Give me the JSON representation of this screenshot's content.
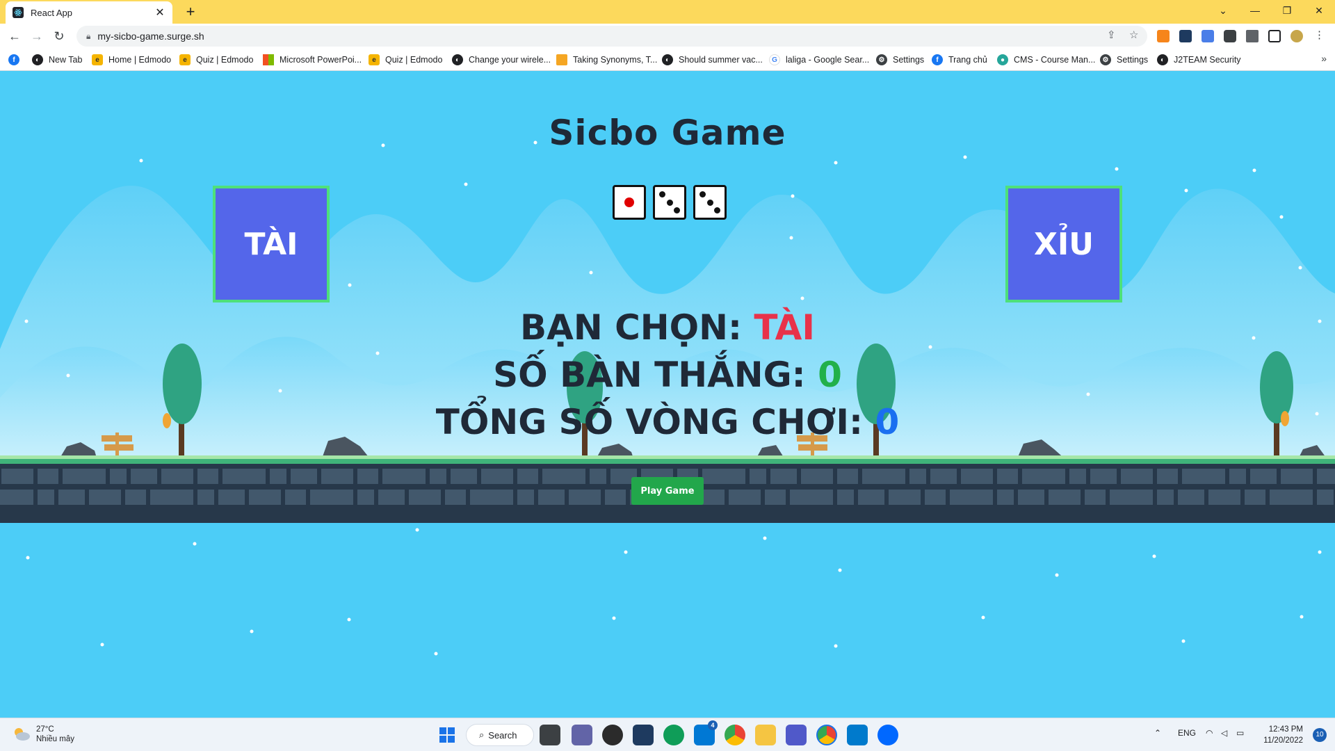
{
  "browser": {
    "tab_title": "React App",
    "tab_close": "✕",
    "new_tab": "+",
    "url": "my-sicbo-game.surge.sh",
    "window_controls": {
      "dropdown": "⌄",
      "minimize": "—",
      "restore": "❐",
      "close": "✕"
    }
  },
  "bookmarks": [
    {
      "label": "New Tab",
      "icon": "globe-icon"
    },
    {
      "label": "Home | Edmodo",
      "icon": "edmodo-icon"
    },
    {
      "label": "Quiz | Edmodo",
      "icon": "edmodo-icon"
    },
    {
      "label": "Microsoft PowerPoi...",
      "icon": "microsoft-icon"
    },
    {
      "label": "Quiz | Edmodo",
      "icon": "edmodo-icon"
    },
    {
      "label": "Change your wirele...",
      "icon": "globe-icon"
    },
    {
      "label": "Taking Synonyms, T...",
      "icon": "thesaurus-icon"
    },
    {
      "label": "Should summer vac...",
      "icon": "globe-icon"
    },
    {
      "label": "laliga - Google Sear...",
      "icon": "google-icon"
    },
    {
      "label": "Settings",
      "icon": "gear-icon"
    },
    {
      "label": "Trang chủ",
      "icon": "facebook-icon"
    },
    {
      "label": "CMS - Course Man...",
      "icon": "cms-icon"
    },
    {
      "label": "Settings",
      "icon": "gear-icon"
    },
    {
      "label": "J2TEAM Security",
      "icon": "globe-icon"
    }
  ],
  "game": {
    "title": "Sicbo Game",
    "dice": [
      1,
      3,
      3
    ],
    "tai_label": "TÀI",
    "xiu_label": "XỈU",
    "choice_label": "BẠN CHỌN: ",
    "choice_value": "TÀI",
    "wins_label": "SỐ BÀN THẮNG: ",
    "wins_value": "0",
    "rounds_label": "TỔNG SỐ VÒNG CHƠI: ",
    "rounds_value": "0",
    "play_button": "Play Game"
  },
  "taskbar": {
    "temperature": "27°C",
    "weather": "Nhiều mây",
    "search": "Search",
    "language": "ENG",
    "time": "12:43 PM",
    "date": "11/20/2022",
    "notifications": "10",
    "mail_badge": "4"
  },
  "colors": {
    "sky": "#4ccdf7",
    "bet_box": "#5466ea",
    "bet_border": "#4ee07a",
    "choice": "#e8324a",
    "wins": "#22b04a",
    "rounds": "#1a6ff0",
    "play_button": "#22a74b"
  }
}
